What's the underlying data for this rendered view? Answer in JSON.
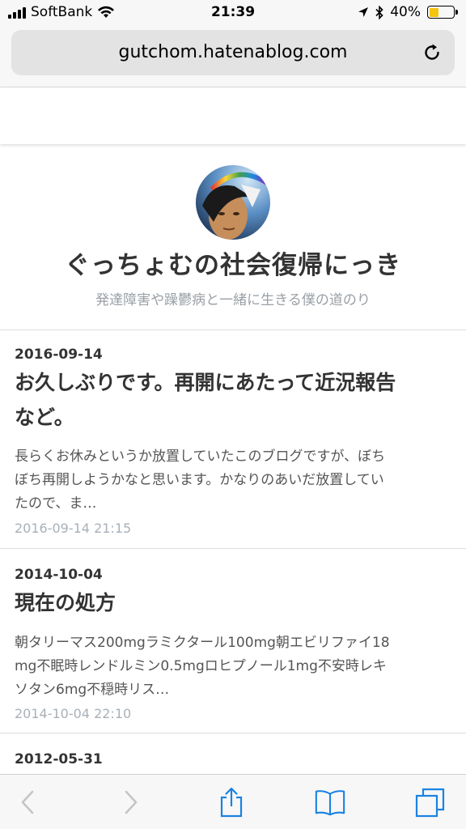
{
  "status_bar": {
    "carrier": "SoftBank",
    "time": "21:39",
    "battery": "40%",
    "battery_level": 0.4
  },
  "browser": {
    "url": "gutchom.hatenablog.com"
  },
  "blog": {
    "title": "ぐっちょむの社会復帰にっき",
    "description": "発達障害や躁鬱病と一緒に生きる僕の道のり"
  },
  "entries": [
    {
      "date": "2016-09-14",
      "title_lines": [
        "お久しぶりです。再開にあたって近況報告",
        "など。"
      ],
      "summary_lines": [
        "長らくお休みというか放置していたこのブログですが、ぼち",
        "ぼち再開しようかなと思います。かなりのあいだ放置してい",
        "たので、ま…"
      ],
      "timestamp": "2016-09-14 21:15"
    },
    {
      "date": "2014-10-04",
      "title_lines": [
        "現在の処方"
      ],
      "summary_lines": [
        "朝タリーマス200mgラミクタール100mg朝エビリファイ18",
        "mg不眠時レンドルミン0.5mgロヒプノール1mg不安時レキ",
        "ソタン6mg不穏時リス…"
      ],
      "timestamp": "2014-10-04 22:10"
    },
    {
      "date": "2012-05-31"
    }
  ],
  "colors": {
    "accent": "#1a82e2",
    "battery": "#f4c40f",
    "muted": "#a8b0b8"
  },
  "icons": {
    "back": "chevron-left-icon",
    "forward": "chevron-right-icon",
    "share": "share-icon",
    "bookmarks": "book-icon",
    "tabs": "tabs-icon",
    "reload": "reload-icon"
  }
}
